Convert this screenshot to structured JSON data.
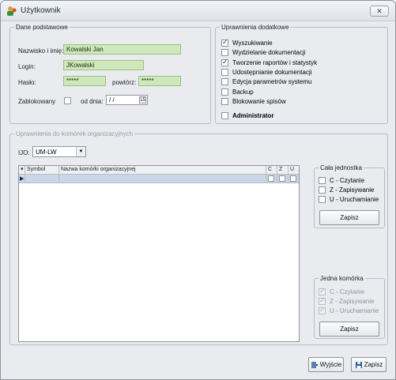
{
  "window": {
    "title": "Użytkownik",
    "close_label": "✕"
  },
  "basic": {
    "legend": "Dane podstawowe",
    "name_label": "Nazwisko i imię:",
    "name_value": "Kowalski Jan",
    "login_label": "Login:",
    "login_value": "JKowalski",
    "password_label": "Hasło:",
    "password_value": "*****",
    "repeat_label": "powtórz:",
    "repeat_value": "*****",
    "blocked_label": "Zablokowany",
    "date_label": "od dnia:",
    "date_value": "/ /",
    "calendar_label": "15"
  },
  "extra": {
    "legend": "Uprawnienia dodatkowe",
    "items": [
      {
        "label": "Wyszukiwanie",
        "checked": true
      },
      {
        "label": "Wydzielanie dokumentacji",
        "checked": false
      },
      {
        "label": "Tworzenie raportów i statystyk",
        "checked": true
      },
      {
        "label": "Udostępnianie dokumentacji",
        "checked": false
      },
      {
        "label": "Edycja parametrów systemu",
        "checked": false
      },
      {
        "label": "Backup",
        "checked": false
      },
      {
        "label": "Blokowanie spisów",
        "checked": false
      }
    ],
    "admin_label": "Administrator"
  },
  "org": {
    "legend": "Uprawnienia do komórek organizacyjnych",
    "ijo_label": "IJO:",
    "ijo_value": "UM-LW",
    "columns": {
      "symbol": "Symbol",
      "name": "Nazwa komórki organizacyjnej",
      "c": "C",
      "z": "Z",
      "u": "U"
    }
  },
  "whole_unit": {
    "legend": "Cała jednostka",
    "options": [
      "C - Czytanie",
      "Z - Zapisywanie",
      "U - Uruchamianie"
    ],
    "save_label": "Zapisz"
  },
  "one_cell": {
    "legend": "Jedna komórka",
    "options": [
      "C - Czytanie",
      "Z - Zapisywanie",
      "U - Uruchamianie"
    ],
    "save_label": "Zapisz"
  },
  "footer": {
    "exit_label": "Wyjście",
    "save_label": "Zapisz"
  }
}
